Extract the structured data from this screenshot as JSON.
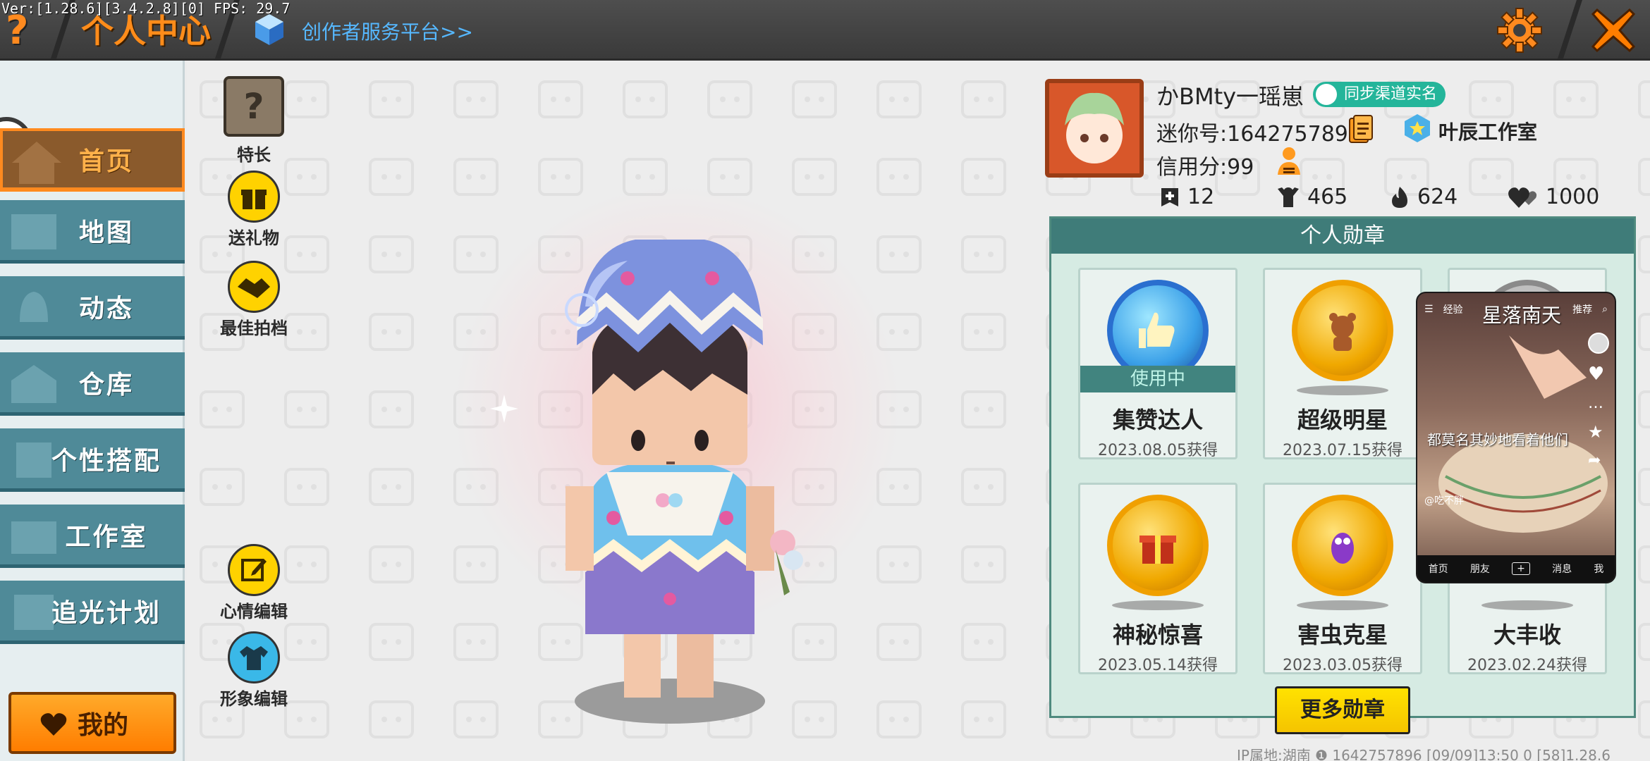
{
  "debug": {
    "fps_text": "Ver:[1.28.6][3.4.2.8][0] FPS: 29.7"
  },
  "header": {
    "help_label": "?",
    "title": "个人中心",
    "creator_link": "创作者服务平台>>"
  },
  "sidebar": {
    "items": [
      {
        "label": "首页",
        "active": true
      },
      {
        "label": "地图",
        "active": false
      },
      {
        "label": "动态",
        "active": false
      },
      {
        "label": "仓库",
        "active": false
      },
      {
        "label": "个性搭配",
        "active": false
      },
      {
        "label": "工作室",
        "active": false
      },
      {
        "label": "追光计划",
        "active": false
      }
    ],
    "me_label": "我的"
  },
  "tools": {
    "specialty": "特长",
    "gift": "送礼物",
    "partner": "最佳拍档",
    "mood_edit": "心情编辑",
    "look_edit": "形象编辑"
  },
  "profile": {
    "username": "かBMty一瑶崽",
    "verify_label": "同步渠道实名",
    "mini_id": "迷你号:1642757896",
    "studio_name": "叶辰工作室",
    "credit": "信用分:99",
    "stats": {
      "plus": "12",
      "fans": "465",
      "fire": "624",
      "likes": "1000"
    }
  },
  "badges": {
    "header": "个人勋章",
    "in_use_label": "使用中",
    "items": [
      {
        "name": "集赞达人",
        "date": "2023.08.05获得",
        "in_use": true
      },
      {
        "name": "超级明星",
        "date": "2023.07.15获得",
        "in_use": false
      },
      {
        "name": "",
        "date": "",
        "in_use": false
      },
      {
        "name": "神秘惊喜",
        "date": "2023.05.14获得",
        "in_use": false
      },
      {
        "name": "害虫克星",
        "date": "2023.03.05获得",
        "in_use": false
      },
      {
        "name": "大丰收",
        "date": "2023.02.24获得",
        "in_use": false
      }
    ],
    "more_label": "更多勋章"
  },
  "video": {
    "tabs": [
      "经验",
      "推荐"
    ],
    "title": "星落南天",
    "caption": "都莫名其妙地看着他们",
    "user": "@吃不胖",
    "nav": [
      "首页",
      "朋友",
      "+",
      "消息",
      "我"
    ]
  },
  "footer": {
    "text": "IP属地:湖南 ❶  1642757896  [09/09]13:50 0  [58]1.28.6"
  },
  "colors": {
    "accent_orange": "#ff8a1f",
    "teal": "#4f8a98",
    "badge_panel": "#d6ebe3",
    "more_button": "#ffe200"
  }
}
